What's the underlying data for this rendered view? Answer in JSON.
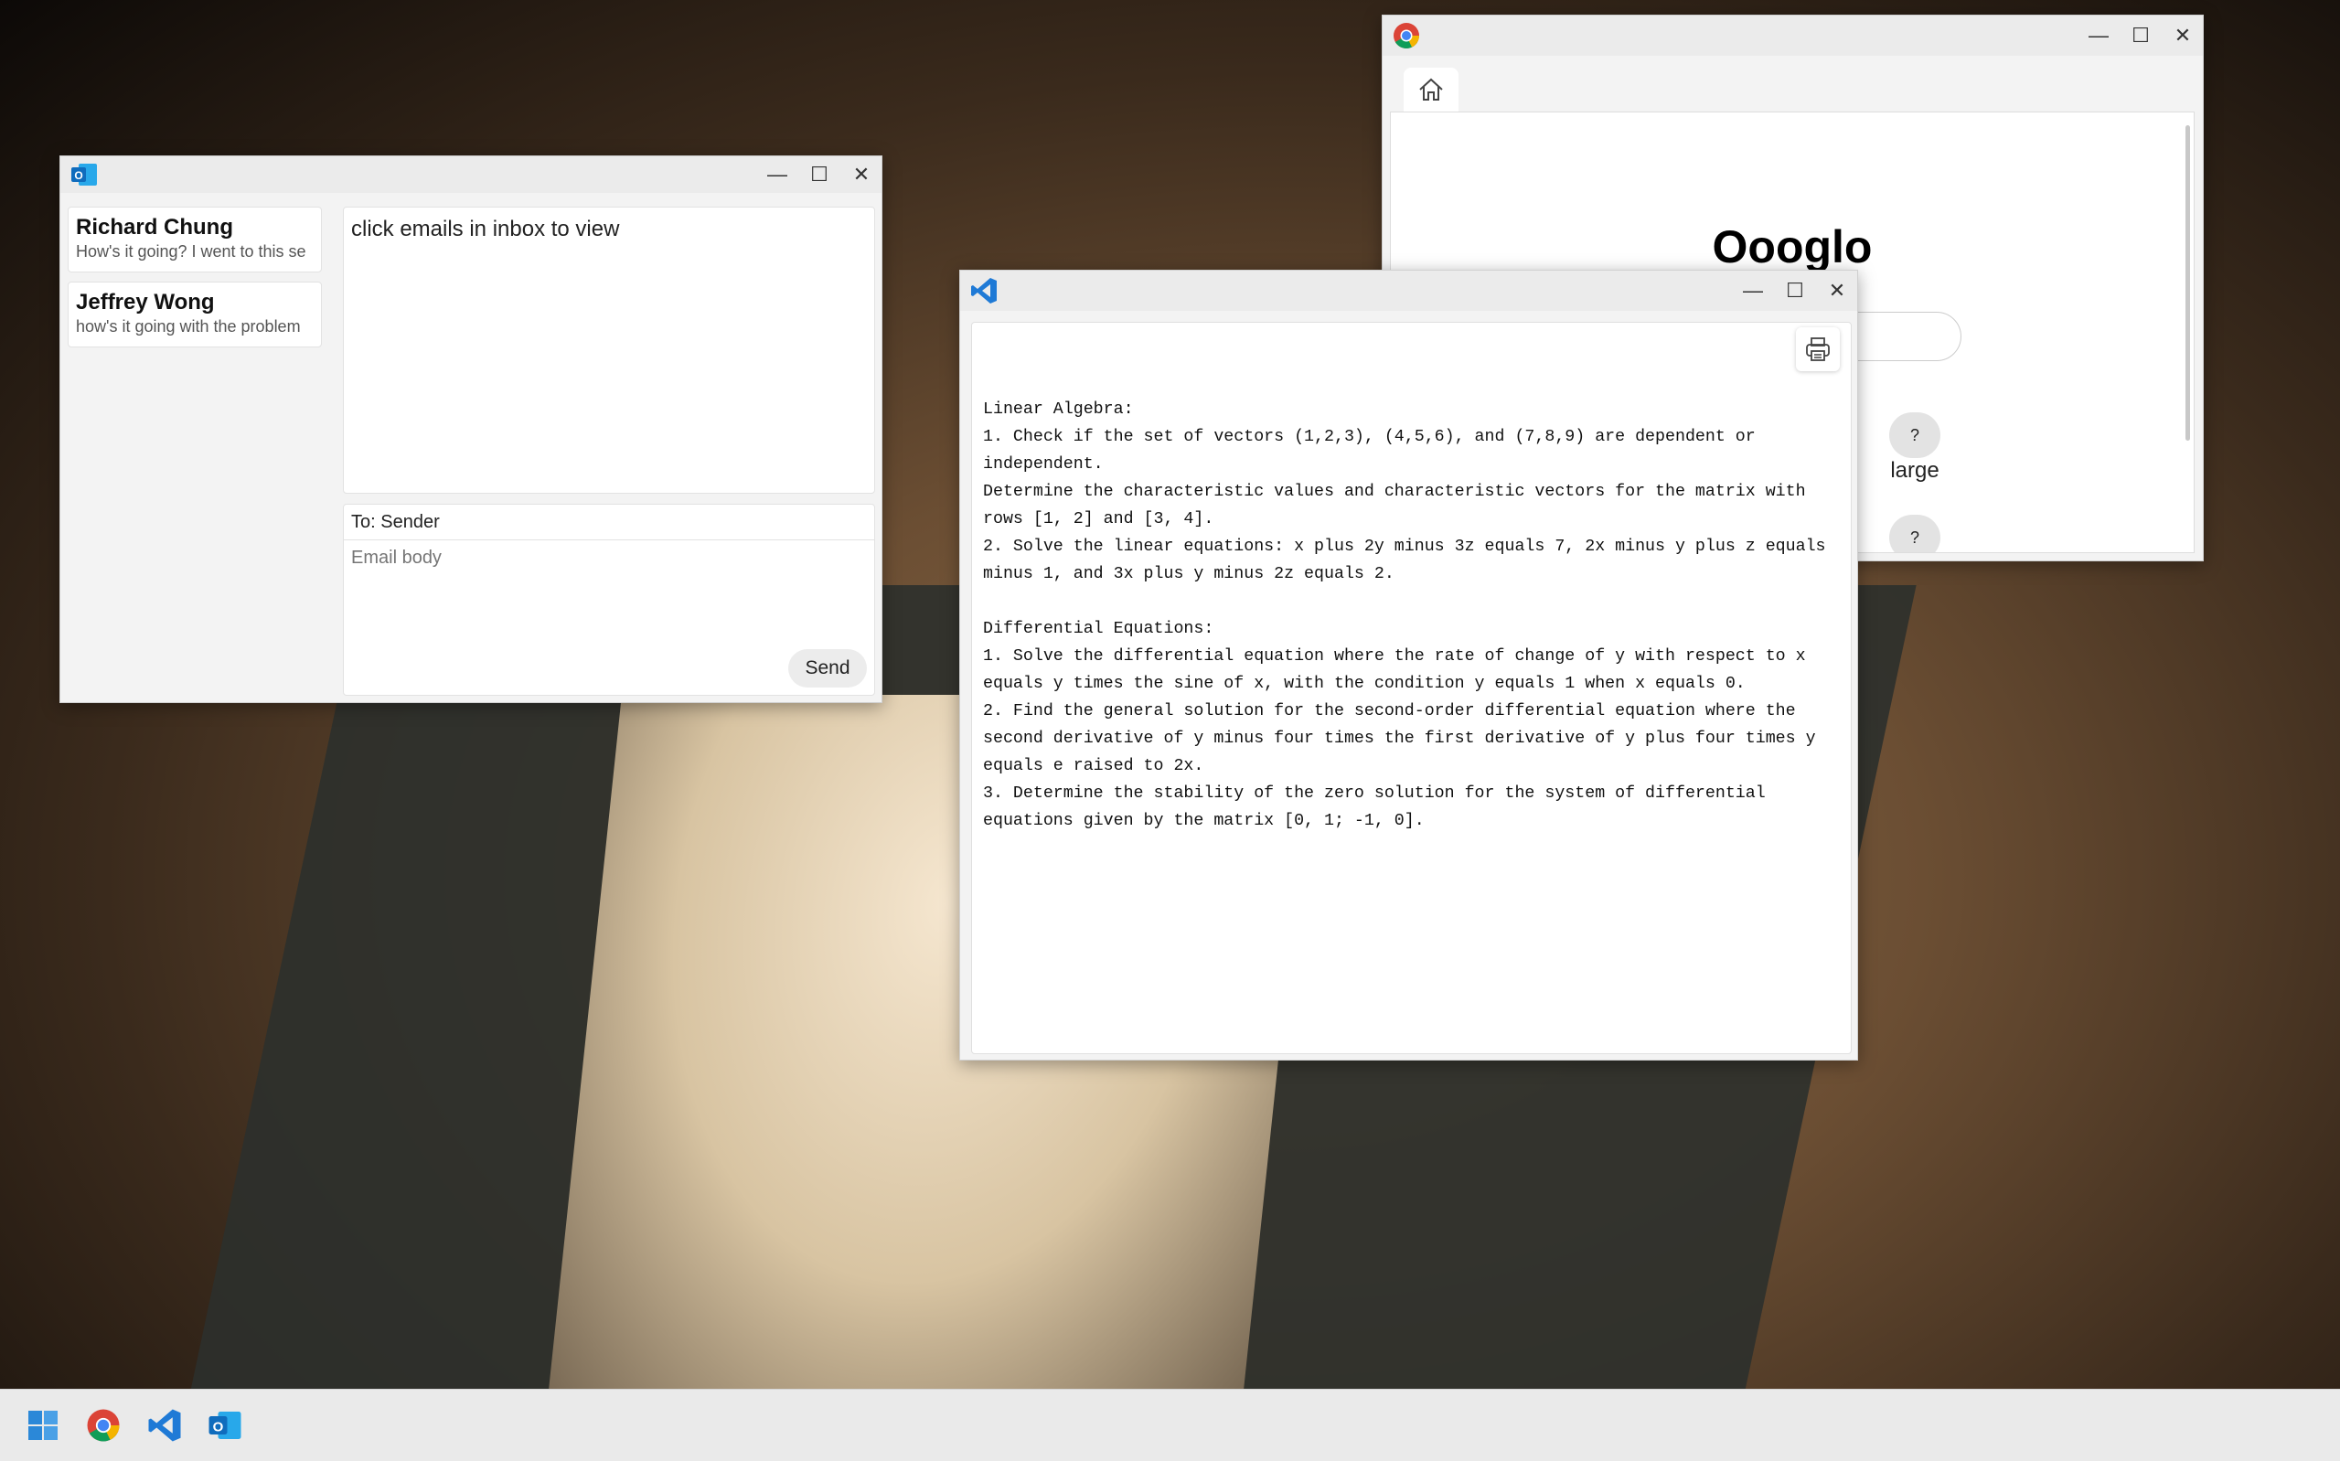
{
  "outlook": {
    "inbox": [
      {
        "sender": "Richard Chung",
        "preview": "How's it going? I went to this se"
      },
      {
        "sender": "Jeffrey Wong",
        "preview": "how's it going with the problem"
      }
    ],
    "reading_pane": "click emails in inbox to view",
    "compose": {
      "to": "To: Sender",
      "body_placeholder": "Email body",
      "send_label": "Send"
    }
  },
  "chrome": {
    "page_title": "Oooglo",
    "search_value": "",
    "button_label": "?",
    "size_label": "large"
  },
  "vscode": {
    "lines": [
      "Linear Algebra:",
      "1. Check if the set of vectors (1,2,3), (4,5,6), and (7,8,9) are dependent or",
      "independent.",
      "Determine the characteristic values and characteristic vectors for the matrix with",
      "rows [1, 2] and [3, 4].",
      "2. Solve the linear equations: x plus 2y minus 3z equals 7, 2x minus y plus z equals",
      "minus 1, and 3x plus y minus 2z equals 2.",
      "",
      "Differential Equations:",
      "1. Solve the differential equation where the rate of change of y with respect to x",
      "equals y times the sine of x, with the condition y equals 1 when x equals 0.",
      "2. Find the general solution for the second-order differential equation where the",
      "second derivative of y minus four times the first derivative of y plus four times y",
      "equals e raised to 2x.",
      "3. Determine the stability of the zero solution for the system of differential",
      "equations given by the matrix [0, 1; -1, 0]."
    ]
  },
  "window_controls": {
    "minimize": "—",
    "maximize": "☐",
    "close": "✕"
  },
  "taskbar": {
    "icons": [
      "windows-start-icon",
      "chrome-icon",
      "vscode-icon",
      "outlook-icon"
    ]
  },
  "colors": {
    "outlook_blue": "#0f6cbd",
    "vscode_blue": "#1f7ad6",
    "button_gray": "#e3e3e3"
  }
}
